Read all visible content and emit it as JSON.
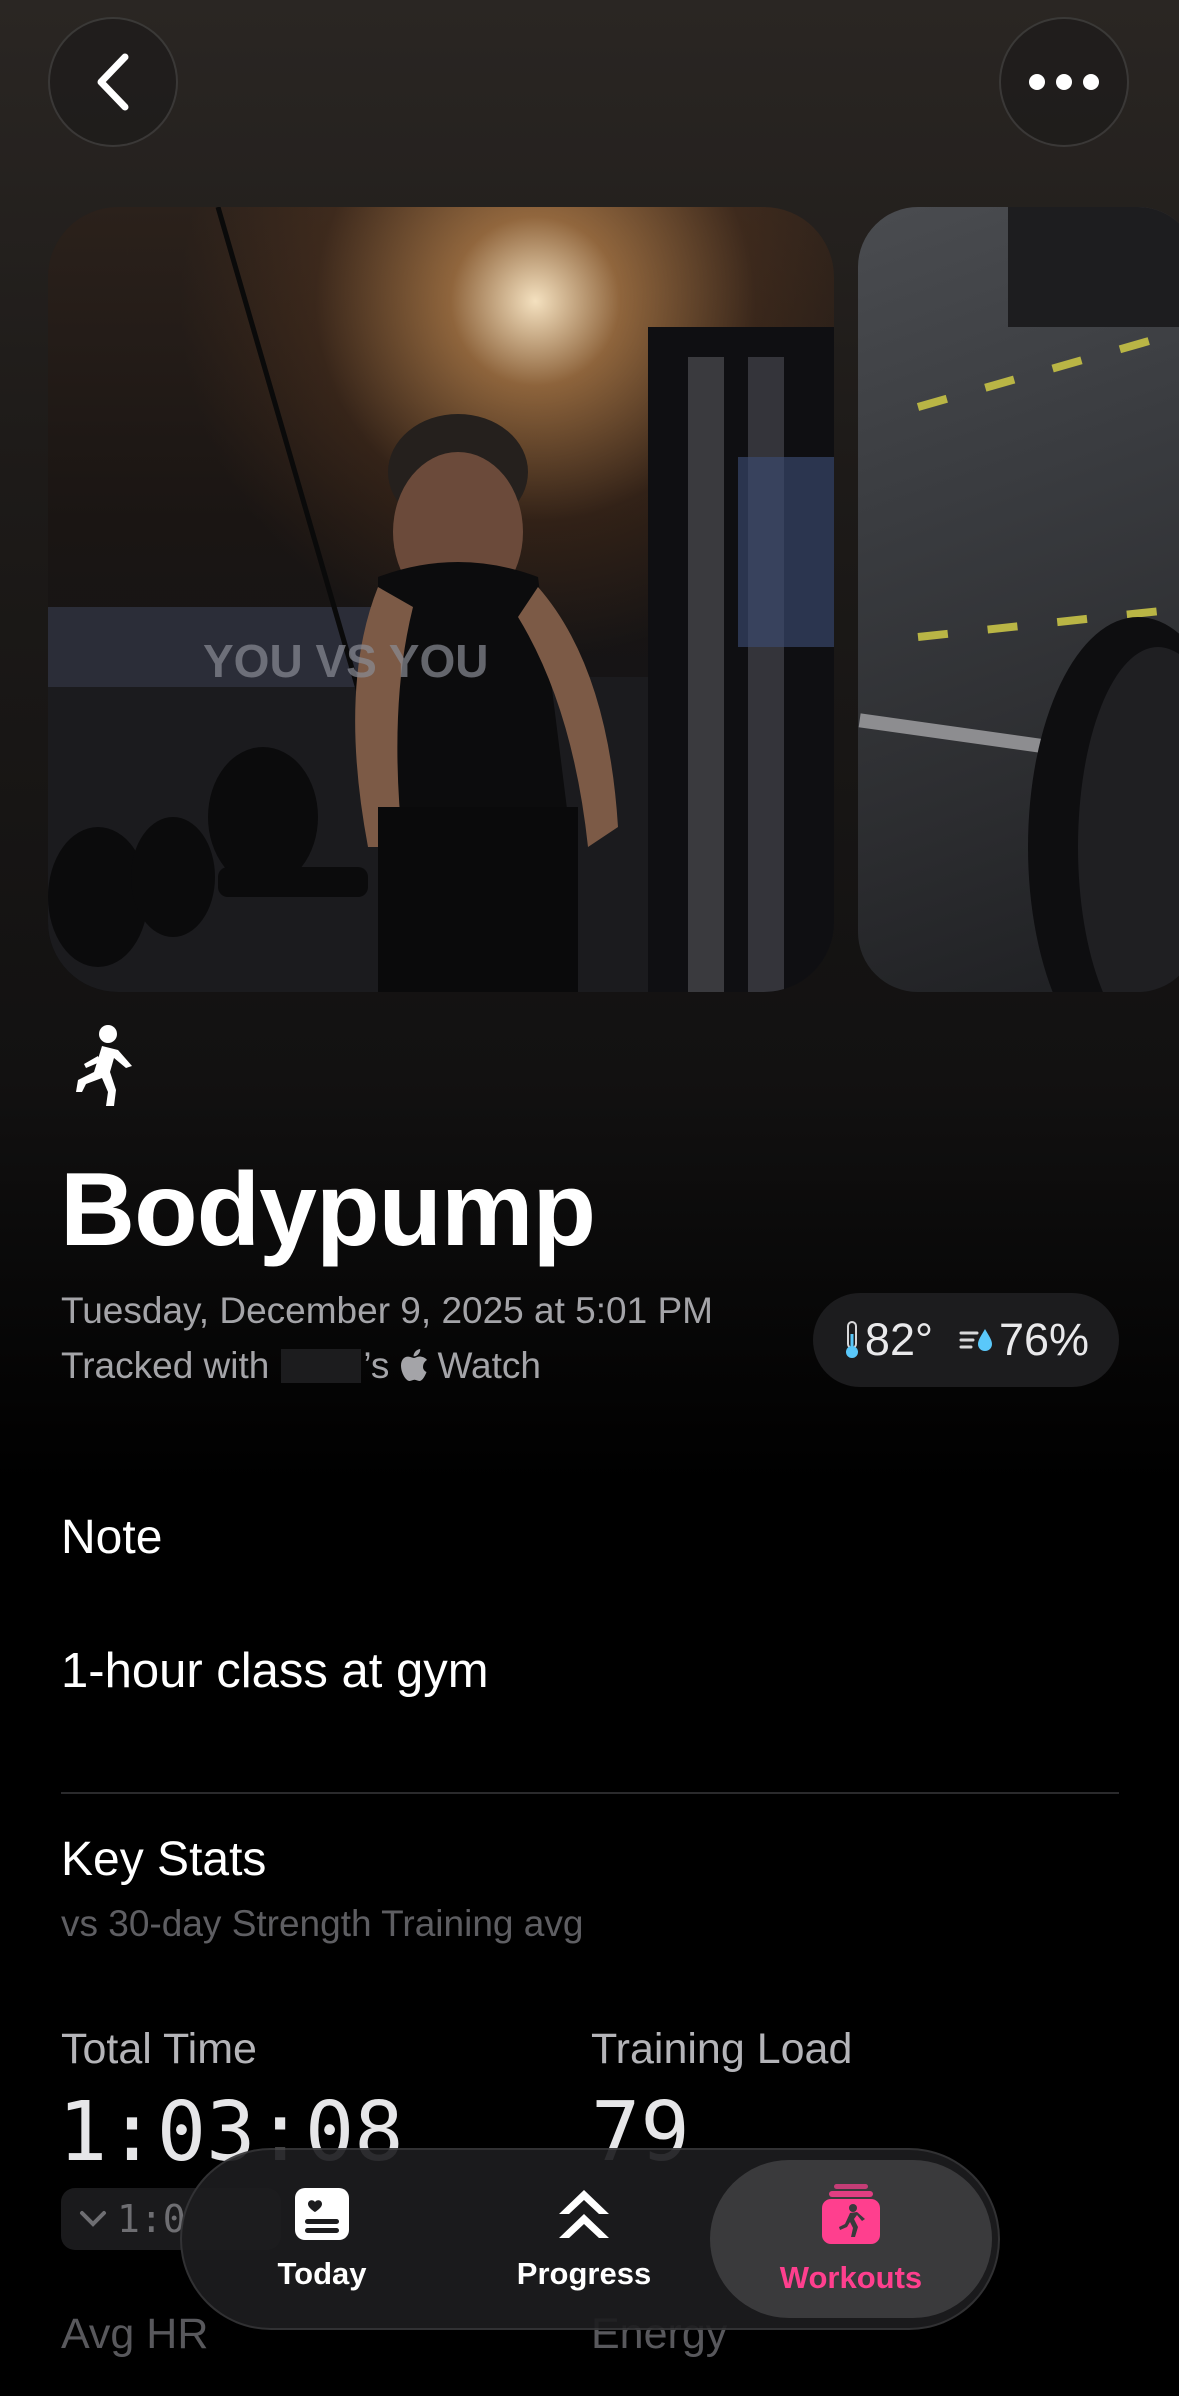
{
  "workout": {
    "title": "Bodypump",
    "date": "Tuesday, December 9, 2025 at 5:01 PM",
    "tracked_prefix": "Tracked with",
    "tracked_suffix": "’s",
    "device": "Watch",
    "activity_icon": "strength-lunge-icon"
  },
  "weather": {
    "temperature": "82°",
    "humidity": "76%"
  },
  "note": {
    "label": "Note",
    "text": "1-hour class at gym"
  },
  "key_stats": {
    "label": "Key Stats",
    "subtitle": "vs 30-day Strength Training avg",
    "total_time": {
      "label": "Total Time",
      "value": "1:03:08",
      "delta": "1:0"
    },
    "training_load": {
      "label": "Training Load",
      "value": "79"
    },
    "avg_hr": {
      "label": "Avg HR"
    },
    "energy": {
      "label": "Energy"
    }
  },
  "tabbar": {
    "tabs": [
      {
        "label": "Today",
        "icon": "today-card-icon",
        "active": false
      },
      {
        "label": "Progress",
        "icon": "chevrons-up-icon",
        "active": false
      },
      {
        "label": "Workouts",
        "icon": "workouts-stack-icon",
        "active": true
      }
    ],
    "accent": "#ff3f8e"
  }
}
